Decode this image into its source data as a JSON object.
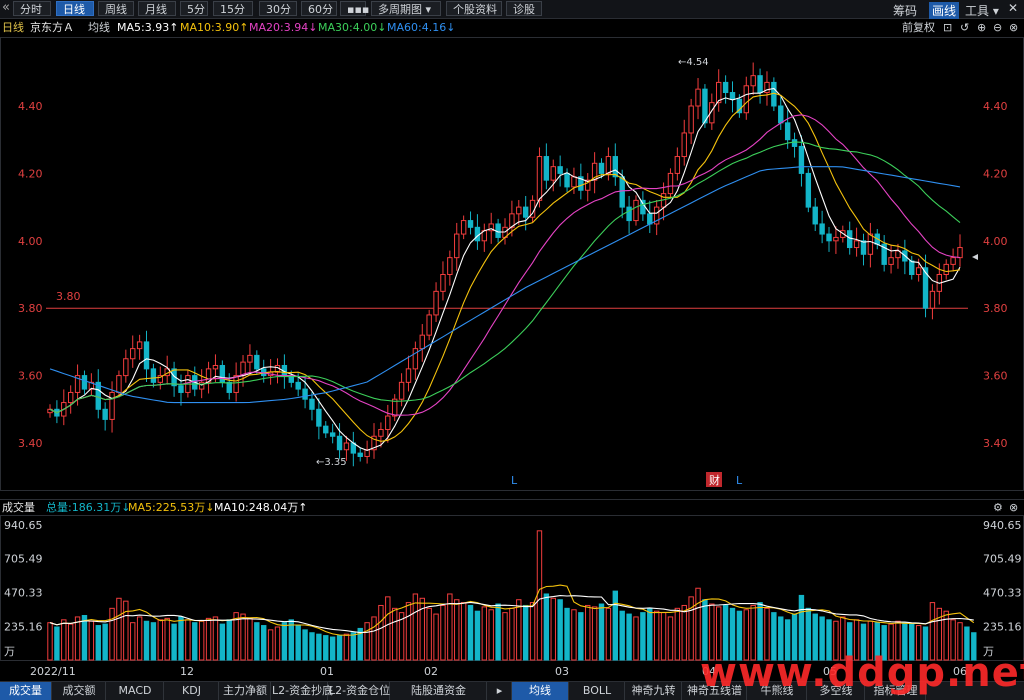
{
  "toolbar": {
    "back_icon": "double-chevron-left-icon",
    "items": [
      {
        "label": "分时",
        "active": false
      },
      {
        "label": "日线",
        "active": true
      },
      {
        "label": "周线",
        "active": false
      },
      {
        "label": "月线",
        "active": false
      },
      {
        "label": "5分",
        "active": false
      },
      {
        "label": "15分",
        "active": false
      },
      {
        "label": "30分",
        "active": false
      },
      {
        "label": "60分",
        "active": false
      },
      {
        "label": "▪▪▪",
        "active": false
      },
      {
        "label": "多周期图 ▾",
        "active": false
      },
      {
        "label": "个股资料",
        "active": false
      },
      {
        "label": "诊股",
        "active": false
      }
    ],
    "right": [
      {
        "label": "筹码",
        "active": false
      },
      {
        "label": "画线",
        "active": true
      },
      {
        "label": "工具 ▾",
        "active": false
      }
    ],
    "close_label": "✕"
  },
  "info": {
    "period": "日线",
    "stock": "京东方Ａ",
    "ma_label": "均线",
    "ma5": "MA5:3.93↑",
    "ma10": "MA10:3.90↑",
    "ma20": "MA20:3.94↓",
    "ma30": "MA30:4.00↓",
    "ma60": "MA60:4.16↓",
    "fuquan": "前复权"
  },
  "vol_info": {
    "title": "成交量",
    "total": "总量:186.31万↓",
    "ma5": "MA5:225.53万↓",
    "ma10": "MA10:248.04万↑"
  },
  "colors": {
    "up": "#f23d3d",
    "down": "#13b5c8",
    "ma5": "#ffffff",
    "ma10": "#f4c20d",
    "ma20": "#e543c4",
    "ma30": "#3ccf5a",
    "ma60": "#2f8ff0",
    "ref_line": "#e04040"
  },
  "tabs": [
    {
      "label": "成交量",
      "active": true
    },
    {
      "label": "成交额",
      "active": false
    },
    {
      "label": "MACD",
      "active": false
    },
    {
      "label": "KDJ",
      "active": false
    },
    {
      "label": "主力净额",
      "active": false
    },
    {
      "label": "L2-资金抄底",
      "active": false
    },
    {
      "label": "L2-资金仓位",
      "active": false
    },
    {
      "label": "陆股通资金",
      "active": false
    },
    {
      "label": "▸",
      "active": false
    },
    {
      "label": "均线",
      "active": true
    },
    {
      "label": "BOLL",
      "active": false
    },
    {
      "label": "神奇九转",
      "active": false
    },
    {
      "label": "神奇五线谱",
      "active": false
    },
    {
      "label": "牛熊线",
      "active": false
    },
    {
      "label": "多空线",
      "active": false
    },
    {
      "label": "指标管理",
      "active": false
    }
  ],
  "watermark": "www.ddgp.net",
  "chart_data": [
    {
      "type": "candlestick",
      "title": "京东方Ａ 日线",
      "y_ticks": [
        "4.40",
        "4.20",
        "4.00",
        "3.80",
        "3.60",
        "3.40"
      ],
      "y_tick_values": [
        4.4,
        4.2,
        4.0,
        3.8,
        3.6,
        3.4
      ],
      "ylim": [
        3.3,
        4.6
      ],
      "reference_line": {
        "value": 3.8,
        "label": "3.80"
      },
      "annotations": [
        {
          "label": "4.54",
          "value": 4.54
        },
        {
          "label": "3.35",
          "value": 3.35
        }
      ],
      "event_markers": [
        "L",
        "财",
        "L"
      ],
      "series_ma": [
        "MA5",
        "MA10",
        "MA20",
        "MA30",
        "MA60"
      ],
      "close": [
        3.5,
        3.48,
        3.52,
        3.55,
        3.6,
        3.56,
        3.58,
        3.5,
        3.47,
        3.55,
        3.6,
        3.65,
        3.68,
        3.7,
        3.62,
        3.58,
        3.6,
        3.62,
        3.57,
        3.55,
        3.6,
        3.56,
        3.58,
        3.62,
        3.63,
        3.58,
        3.55,
        3.6,
        3.64,
        3.66,
        3.62,
        3.6,
        3.61,
        3.63,
        3.6,
        3.58,
        3.56,
        3.53,
        3.5,
        3.45,
        3.43,
        3.42,
        3.38,
        3.4,
        3.37,
        3.36,
        3.38,
        3.42,
        3.44,
        3.48,
        3.53,
        3.58,
        3.62,
        3.68,
        3.72,
        3.78,
        3.85,
        3.9,
        3.95,
        4.02,
        4.06,
        4.04,
        4.0,
        4.03,
        4.05,
        4.01,
        4.04,
        4.08,
        4.1,
        4.07,
        4.12,
        4.25,
        4.18,
        4.22,
        4.2,
        4.16,
        4.19,
        4.15,
        4.18,
        4.23,
        4.2,
        4.25,
        4.19,
        4.1,
        4.06,
        4.12,
        4.08,
        4.05,
        4.1,
        4.14,
        4.2,
        4.25,
        4.32,
        4.4,
        4.45,
        4.35,
        4.41,
        4.47,
        4.44,
        4.42,
        4.38,
        4.46,
        4.49,
        4.44,
        4.47,
        4.4,
        4.35,
        4.3,
        4.28,
        4.2,
        4.1,
        4.05,
        4.02,
        4.0,
        4.01,
        4.03,
        3.98,
        4.0,
        3.96,
        4.02,
        3.99,
        3.93,
        3.95,
        3.97,
        3.94,
        3.9,
        3.92,
        3.8,
        3.85,
        3.9,
        3.93,
        3.95,
        3.98
      ],
      "volume_wan": [
        260,
        230,
        280,
        250,
        300,
        310,
        270,
        240,
        250,
        360,
        430,
        410,
        260,
        300,
        270,
        260,
        280,
        290,
        250,
        300,
        280,
        260,
        270,
        290,
        300,
        250,
        280,
        330,
        320,
        290,
        260,
        240,
        210,
        230,
        260,
        280,
        240,
        210,
        190,
        180,
        170,
        160,
        170,
        180,
        190,
        220,
        260,
        300,
        380,
        440,
        360,
        330,
        400,
        460,
        430,
        360,
        320,
        380,
        460,
        420,
        400,
        380,
        340,
        370,
        350,
        390,
        330,
        360,
        420,
        380,
        400,
        900,
        460,
        430,
        420,
        360,
        350,
        330,
        380,
        370,
        390,
        360,
        480,
        340,
        320,
        300,
        330,
        360,
        340,
        330,
        300,
        360,
        380,
        440,
        500,
        420,
        390,
        370,
        380,
        360,
        340,
        350,
        380,
        400,
        360,
        330,
        300,
        280,
        320,
        450,
        360,
        320,
        300,
        280,
        270,
        300,
        260,
        280,
        250,
        270,
        260,
        240,
        250,
        270,
        260,
        250,
        240,
        230,
        400,
        360,
        340,
        280,
        260,
        230,
        190
      ],
      "volume_y_ticks": [
        "940.65",
        "705.49",
        "470.33",
        "235.16",
        "万"
      ],
      "volume_ylim": [
        0,
        940.65
      ],
      "x_ticks": [
        "2022/11",
        "12",
        "01",
        "02",
        "03",
        "04",
        "05",
        "06"
      ]
    }
  ]
}
